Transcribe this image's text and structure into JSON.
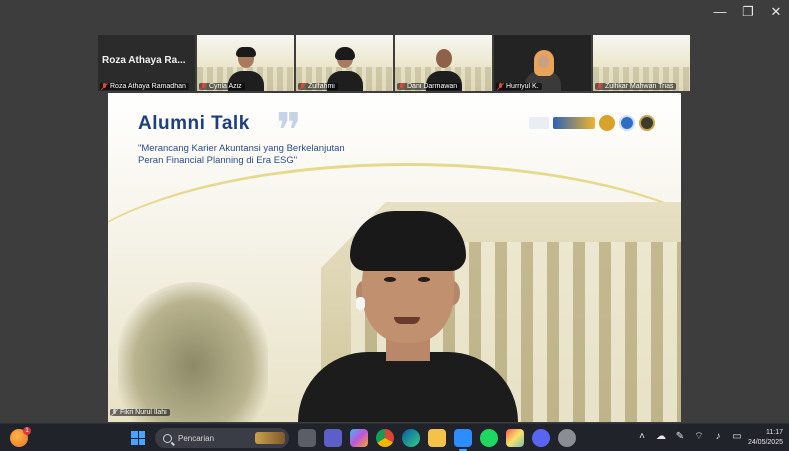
{
  "window": {
    "controls": {
      "minimize": "—",
      "restore": "❐",
      "close": "✕"
    }
  },
  "participants": [
    {
      "name": "Roza Athaya Ramadhan",
      "display_name": "Roza Athaya Ra...",
      "muted": true,
      "video": false
    },
    {
      "name": "Cyrila Aziz",
      "muted": true,
      "video": true
    },
    {
      "name": "Zulfahmi",
      "muted": true,
      "video": true
    },
    {
      "name": "Dani Darmawan",
      "muted": true,
      "video": true
    },
    {
      "name": "Hurriyul K.",
      "muted": true,
      "video": true
    },
    {
      "name": "Zulfikar Mahwan Trias",
      "muted": true,
      "video": true
    }
  ],
  "presentation": {
    "title": "Alumni  Talk",
    "subtitle_line1": "\"Merancang Karier Akuntansi yang Berkelanjutan",
    "subtitle_line2": "Peran Financial Planning di Era ESG\"",
    "presenter_label": "Fikri Nurul Ilahi"
  },
  "taskbar": {
    "search_placeholder": "Pencarian",
    "weather_badge": "1",
    "time": "11:17",
    "date": "24/05/2025",
    "apps": [
      "task-view-icon",
      "teams-icon",
      "copilot-icon",
      "chrome-icon",
      "edge-icon",
      "file-explorer-icon",
      "zoom-icon",
      "spotify-icon",
      "photos-icon",
      "discord-icon",
      "settings-icon"
    ]
  },
  "colors": {
    "title_blue": "#1e3f7d",
    "accent_gold": "#e7d98b",
    "mic_muted": "#e4443b"
  }
}
